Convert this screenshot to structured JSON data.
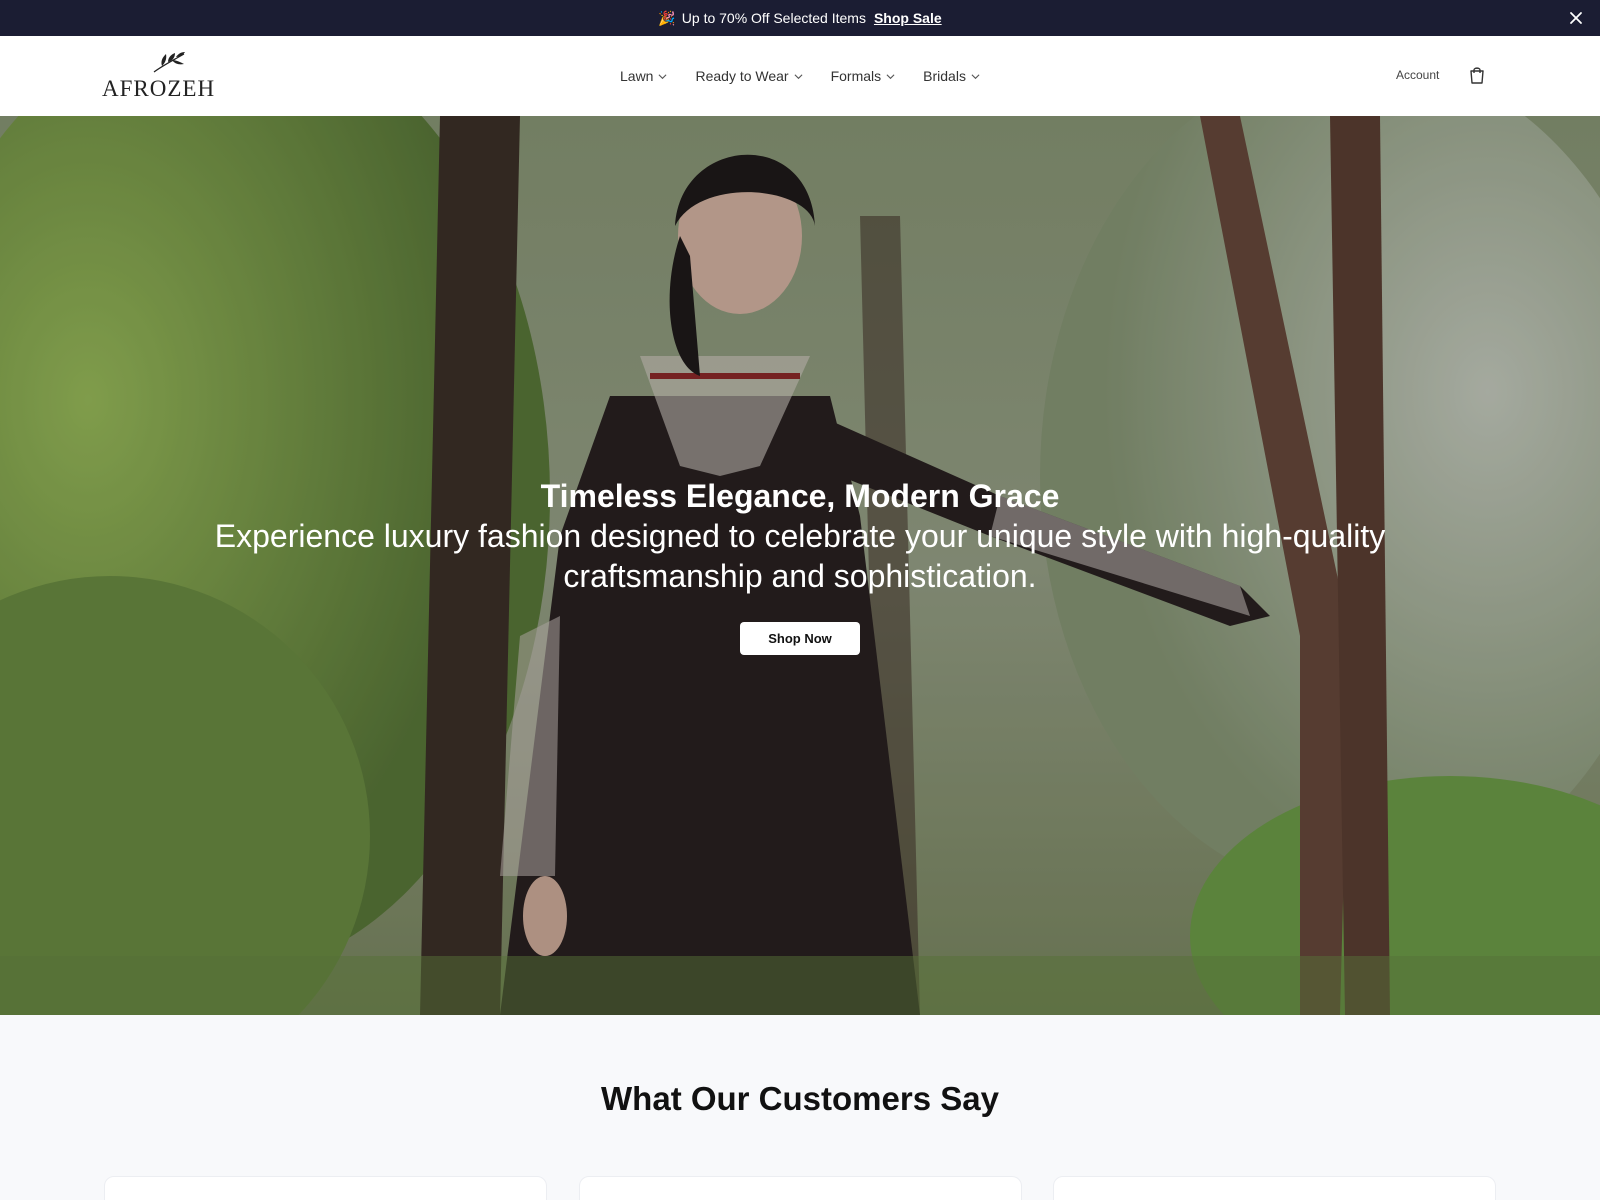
{
  "announcement": {
    "emoji": "🎉",
    "text": "Up to 70% Off Selected Items",
    "link_label": "Shop Sale",
    "close_icon": "close-icon"
  },
  "header": {
    "logo_text": "AFROZEH",
    "nav": [
      {
        "label": "Lawn"
      },
      {
        "label": "Ready to Wear"
      },
      {
        "label": "Formals"
      },
      {
        "label": "Bridals"
      }
    ],
    "account_label": "Account",
    "cart_icon": "shopping-bag-icon"
  },
  "hero": {
    "title": "Timeless Elegance, Modern Grace",
    "subtitle": "Experience luxury fashion designed to celebrate your unique style with high-quality craftsmanship and sophistication.",
    "cta_label": "Shop Now"
  },
  "testimonials": {
    "title": "What Our Customers Say"
  },
  "colors": {
    "announcement_bg": "#1b1d33",
    "header_bg": "#ffffff",
    "page_bg": "#f8f9fb"
  }
}
